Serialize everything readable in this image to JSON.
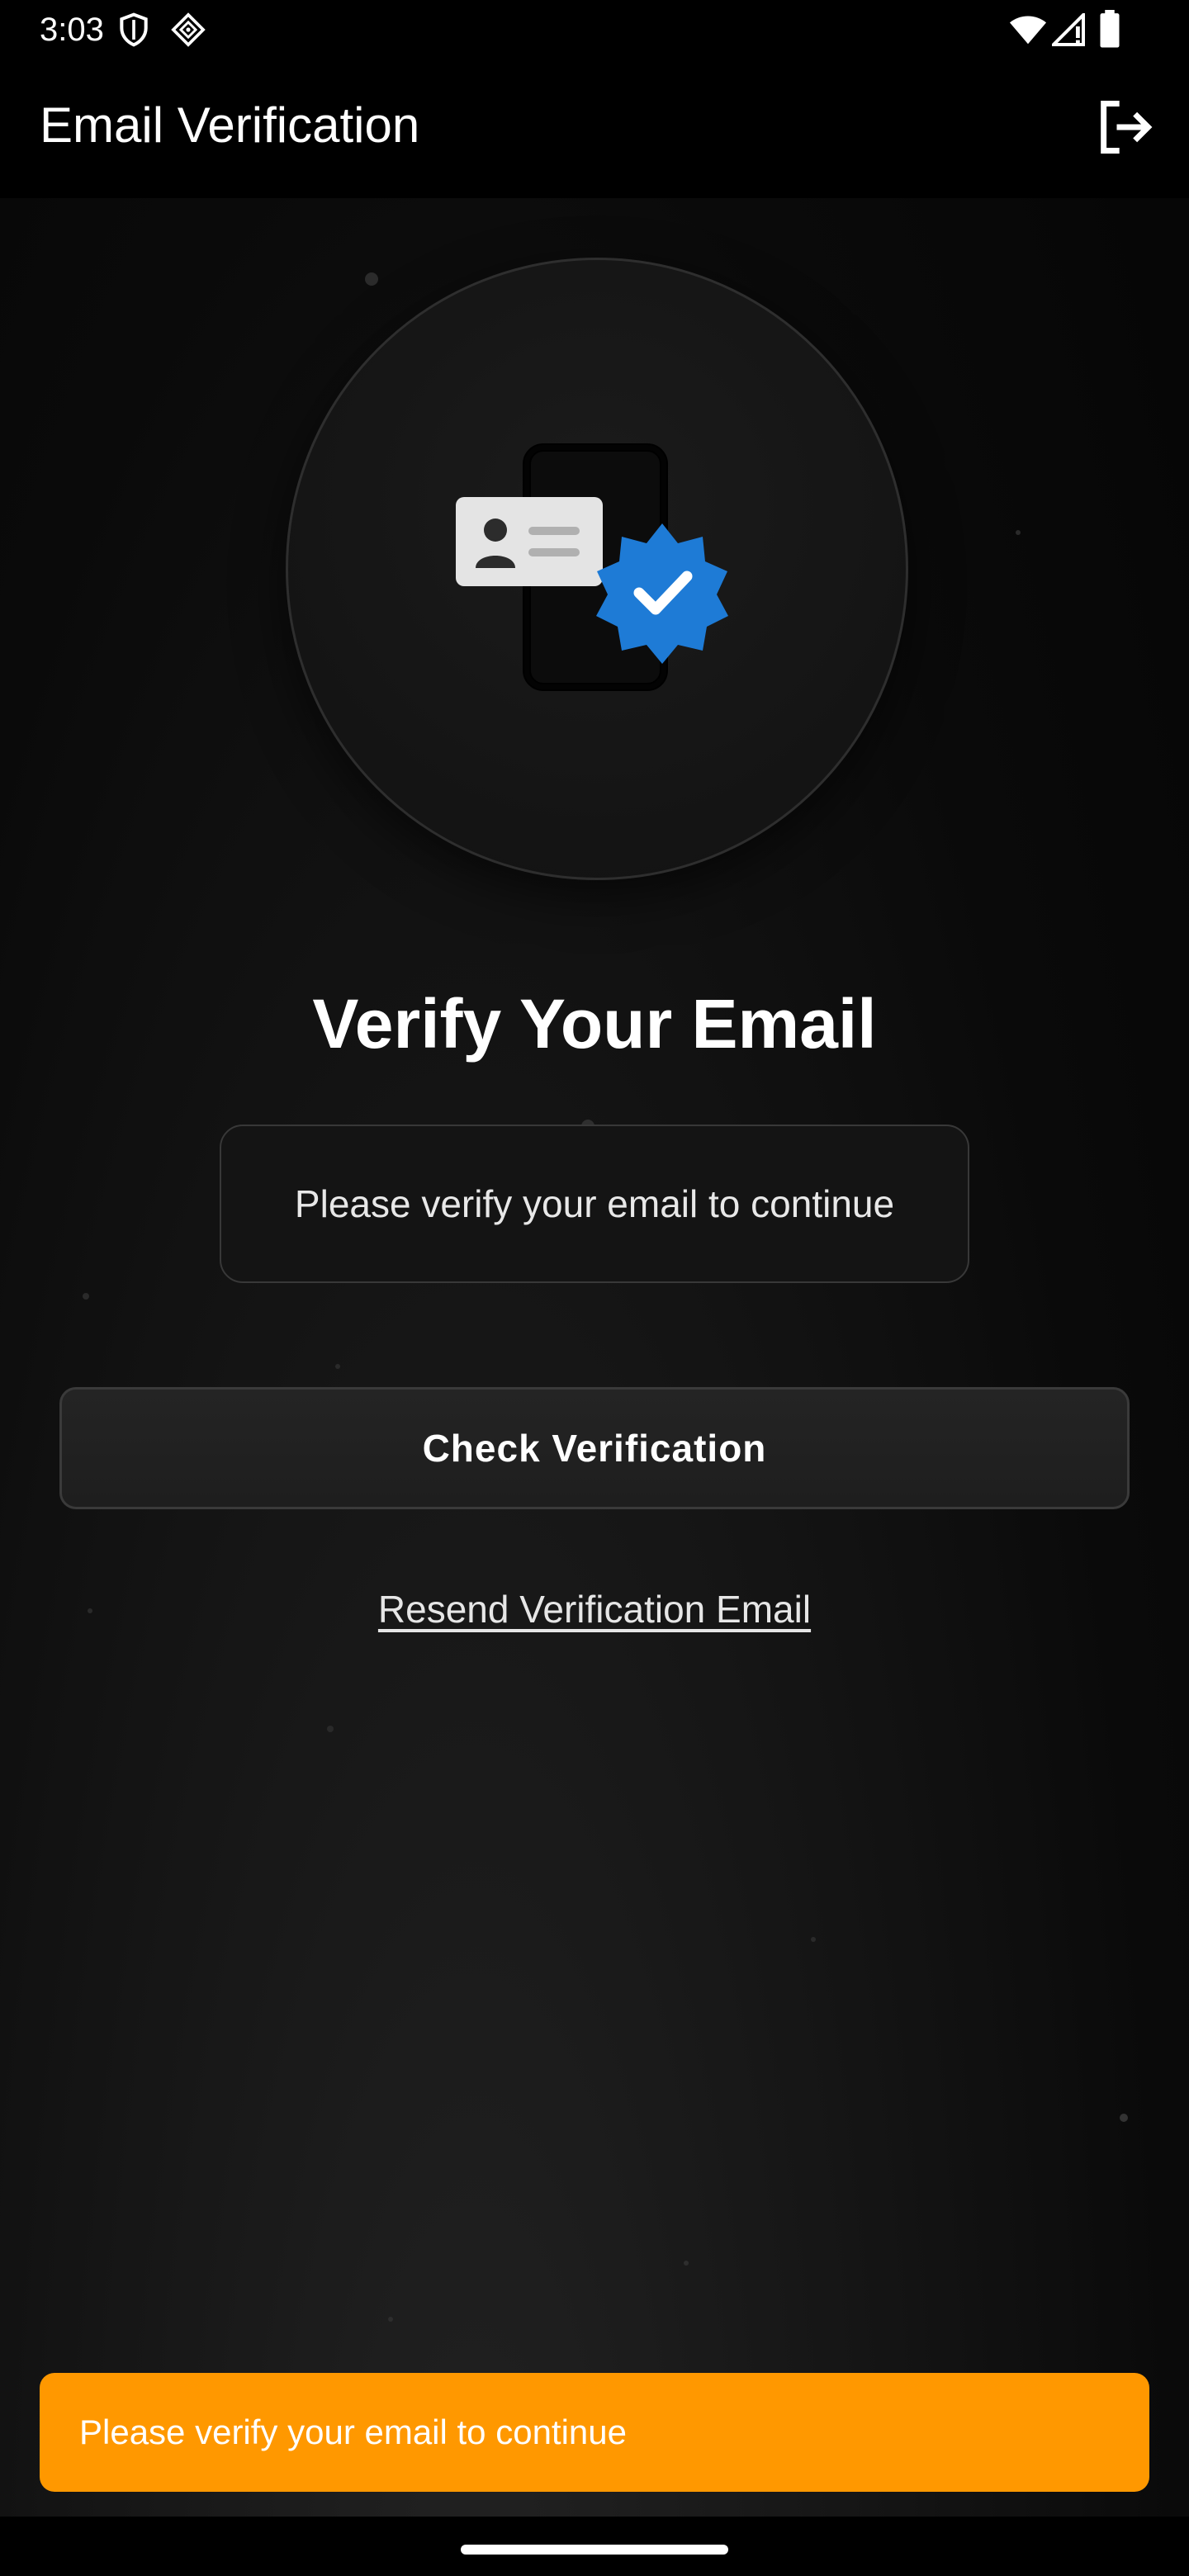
{
  "status_bar": {
    "time": "3:03",
    "icons": [
      "shield-icon",
      "vpn-key-icon",
      "wifi-icon",
      "cell-signal-icon",
      "battery-icon"
    ]
  },
  "app_bar": {
    "title": "Email Verification",
    "logout_icon": "logout-icon"
  },
  "hero": {
    "illustration": "id-card-phone-verified-icon",
    "badge_color": "#1e7bd6"
  },
  "main": {
    "heading": "Verify Your Email",
    "info_message": "Please verify your email to continue",
    "check_button_label": "Check Verification",
    "resend_link_label": "Resend Verification Email"
  },
  "snackbar": {
    "message": "Please verify your email to continue",
    "color": "#ff9800"
  }
}
